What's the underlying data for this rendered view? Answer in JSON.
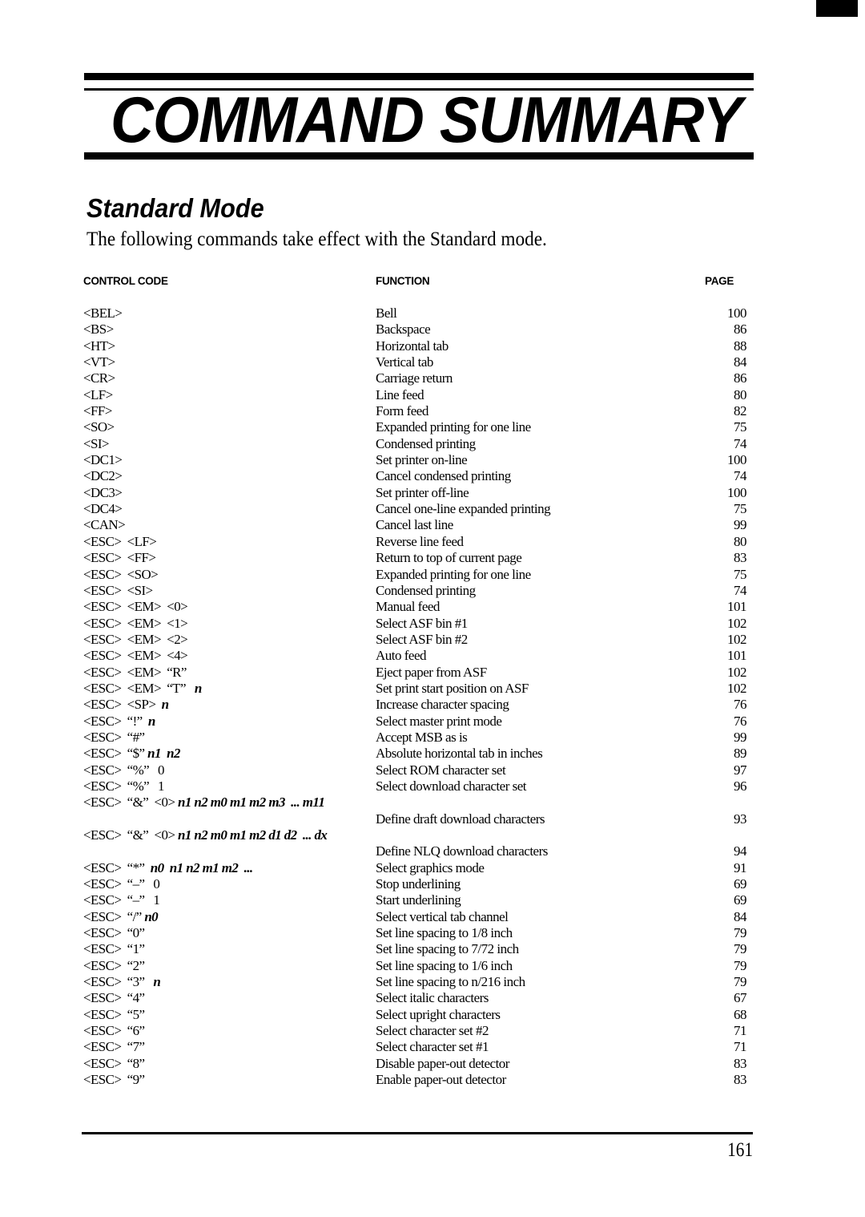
{
  "header": {
    "title": "COMMAND SUMMARY"
  },
  "section": {
    "title": "Standard Mode",
    "intro": "The following commands take effect with the Standard mode."
  },
  "table": {
    "columns": {
      "code": "CONTROL CODE",
      "function": "FUNCTION",
      "page": "PAGE"
    },
    "rows": [
      {
        "code": "<BEL>",
        "args": "",
        "function": "Bell",
        "page": "100"
      },
      {
        "code": "<BS>",
        "args": "",
        "function": "Backspace",
        "page": "86"
      },
      {
        "code": "<HT>",
        "args": "",
        "function": "Horizontal tab",
        "page": "88"
      },
      {
        "code": "<VT>",
        "args": "",
        "function": "Vertical tab",
        "page": "84"
      },
      {
        "code": "<CR>",
        "args": "",
        "function": "Carriage return",
        "page": "86"
      },
      {
        "code": "<LF>",
        "args": "",
        "function": "Line feed",
        "page": "80"
      },
      {
        "code": "<FF>",
        "args": "",
        "function": "Form feed",
        "page": "82"
      },
      {
        "code": "<SO>",
        "args": "",
        "function": "Expanded printing for one line",
        "page": "75"
      },
      {
        "code": "<SI>",
        "args": "",
        "function": "Condensed printing",
        "page": "74"
      },
      {
        "code": "<DC1>",
        "args": "",
        "function": "Set printer on-line",
        "page": "100"
      },
      {
        "code": "<DC2>",
        "args": "",
        "function": "Cancel condensed printing",
        "page": "74"
      },
      {
        "code": "<DC3>",
        "args": "",
        "function": "Set printer off-line",
        "page": "100"
      },
      {
        "code": "<DC4>",
        "args": "",
        "function": "Cancel one-line expanded printing",
        "page": "75"
      },
      {
        "code": "<CAN>",
        "args": "",
        "function": "Cancel last line",
        "page": "99"
      },
      {
        "code": "<ESC>  <LF>",
        "args": "",
        "function": "Reverse line feed",
        "page": "80"
      },
      {
        "code": "<ESC>  <FF>",
        "args": "",
        "function": "Return to top of current page",
        "page": "83"
      },
      {
        "code": "<ESC>  <SO>",
        "args": "",
        "function": "Expanded printing for one line",
        "page": "75"
      },
      {
        "code": "<ESC>  <SI>",
        "args": "",
        "function": "Condensed printing",
        "page": "74"
      },
      {
        "code": "<ESC>  <EM>  <0>",
        "args": "",
        "function": "Manual feed",
        "page": "101"
      },
      {
        "code": "<ESC>  <EM>  <1>",
        "args": "",
        "function": "Select ASF bin #1",
        "page": "102"
      },
      {
        "code": "<ESC>  <EM>  <2>",
        "args": "",
        "function": "Select ASF bin #2",
        "page": "102"
      },
      {
        "code": "<ESC>  <EM>  <4>",
        "args": "",
        "function": "Auto feed",
        "page": "101"
      },
      {
        "code": "<ESC>  <EM>  “R”",
        "args": "",
        "function": "Eject paper from ASF",
        "page": "102"
      },
      {
        "code": "<ESC>  <EM>  “T”   ",
        "args": "n",
        "function": "Set print start position on ASF",
        "page": "102"
      },
      {
        "code": "<ESC>  <SP>  ",
        "args": "n",
        "function": "Increase character spacing",
        "page": "76"
      },
      {
        "code": "<ESC>  “!”  ",
        "args": "n",
        "function": "Select master print mode",
        "page": "76"
      },
      {
        "code": "<ESC>  “#”",
        "args": "",
        "function": "Accept MSB as is",
        "page": "99"
      },
      {
        "code": "<ESC>  “$” ",
        "args": "n1  n2",
        "function": "Absolute horizontal tab in inches",
        "page": "89"
      },
      {
        "code": "<ESC>  “%”   0",
        "args": "",
        "function": "Select ROM character set",
        "page": "97"
      },
      {
        "code": "<ESC>  “%”   1",
        "args": "",
        "function": "Select download character set",
        "page": "96"
      },
      {
        "code": "<ESC>  “&”  <0> ",
        "args": "n1 n2 m0 m1 m2 m3  ... m11",
        "function": "",
        "page": ""
      },
      {
        "code": "",
        "args": "",
        "function": "Define draft download characters",
        "page": "93"
      },
      {
        "code": "<ESC>  “&”  <0> ",
        "args": "n1 n2 m0 m1 m2 d1 d2  ... dx",
        "function": "",
        "page": ""
      },
      {
        "code": "",
        "args": "",
        "function": "Define NLQ download characters",
        "page": "94"
      },
      {
        "code": "<ESC>  “*”  ",
        "args": "n0  n1 n2 m1 m2  ...",
        "function": "Select graphics mode",
        "page": "91"
      },
      {
        "code": "<ESC>  “–”   0",
        "args": "",
        "function": "Stop underlining",
        "page": "69"
      },
      {
        "code": "<ESC>  “–”   1",
        "args": "",
        "function": "Start underlining",
        "page": "69"
      },
      {
        "code": "<ESC>  “/” ",
        "args": "n0",
        "function": "Select vertical tab channel",
        "page": "84"
      },
      {
        "code": "<ESC>  “0”",
        "args": "",
        "function": "Set line spacing to 1/8 inch",
        "page": "79"
      },
      {
        "code": "<ESC>  “1”",
        "args": "",
        "function": "Set line spacing to 7/72 inch",
        "page": "79"
      },
      {
        "code": "<ESC>  “2”",
        "args": "",
        "function": "Set line spacing to 1/6 inch",
        "page": "79"
      },
      {
        "code": "<ESC>  “3”   ",
        "args": "n",
        "function": "Set line spacing to n/216 inch",
        "page": "79"
      },
      {
        "code": "<ESC>  “4”",
        "args": "",
        "function": "Select italic characters",
        "page": "67"
      },
      {
        "code": "<ESC>  “5”",
        "args": "",
        "function": "Select upright characters",
        "page": "68"
      },
      {
        "code": "<ESC>  “6”",
        "args": "",
        "function": "Select character set #2",
        "page": "71"
      },
      {
        "code": "<ESC>  “7”",
        "args": "",
        "function": "Select character set #1",
        "page": "71"
      },
      {
        "code": "<ESC>  “8”",
        "args": "",
        "function": "Disable paper-out detector",
        "page": "83"
      },
      {
        "code": "<ESC>  “9”",
        "args": "",
        "function": "Enable paper-out detector",
        "page": "83"
      }
    ]
  },
  "footer": {
    "page_number": "161"
  }
}
